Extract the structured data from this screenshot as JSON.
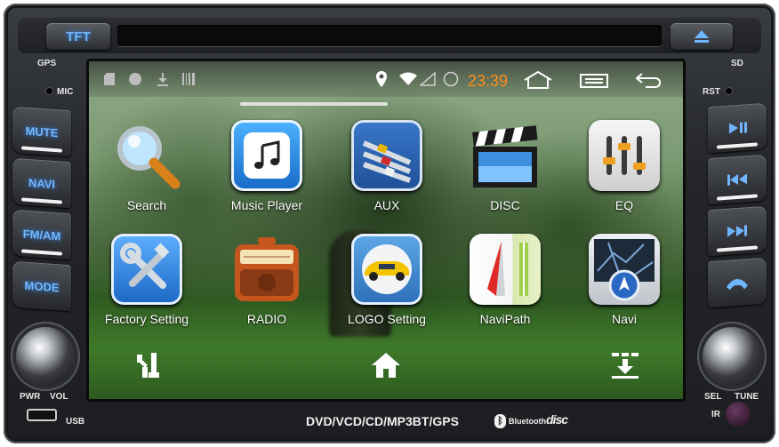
{
  "device": {
    "tft_label": "TFT",
    "gps_label": "GPS",
    "mic_label": "MIC",
    "sd_label": "SD",
    "rst_label": "RST",
    "left_buttons": [
      "MUTE",
      "NAVI",
      "FM/AM",
      "MODE"
    ],
    "right_buttons": [
      "play-pause-icon",
      "previous-icon",
      "next-icon",
      "phone-icon"
    ],
    "pwr_label": "PWR",
    "vol_label": "VOL",
    "sel_label": "SEL",
    "tune_label": "TUNE",
    "ir_label": "IR",
    "usb_label": "USB",
    "bottom_title": "DVD/VCD/CD/MP3BT/GPS",
    "bluetooth_label": "Bluetooth",
    "disc_logo": "disc",
    "accent_color": "#6fb6ff"
  },
  "statusbar": {
    "time": "23:39",
    "time_color": "#ff8c1a",
    "left_icons": [
      "sd-card-icon",
      "circle-icon",
      "download-icon",
      "barcode-icon"
    ],
    "right_icons": [
      "location-icon",
      "wifi-icon",
      "signal-icon",
      "ring-icon"
    ],
    "nav_icons": [
      "home-icon",
      "menu-icon",
      "back-icon"
    ]
  },
  "apps": [
    {
      "label": "Search",
      "icon": "search-icon"
    },
    {
      "label": "Music Player",
      "icon": "music-icon"
    },
    {
      "label": "AUX",
      "icon": "aux-cable-icon"
    },
    {
      "label": "DISC",
      "icon": "clapperboard-icon"
    },
    {
      "label": "EQ",
      "icon": "equalizer-icon"
    },
    {
      "label": "Factory Setting",
      "icon": "tools-icon"
    },
    {
      "label": "RADIO",
      "icon": "radio-icon"
    },
    {
      "label": "LOGO Setting",
      "icon": "car-icon"
    },
    {
      "label": "NaviPath",
      "icon": "compass-map-icon"
    },
    {
      "label": "Navi",
      "icon": "navigation-map-icon"
    }
  ],
  "dock": [
    "settings-tools-icon",
    "home-icon",
    "app-drawer-download-icon"
  ]
}
